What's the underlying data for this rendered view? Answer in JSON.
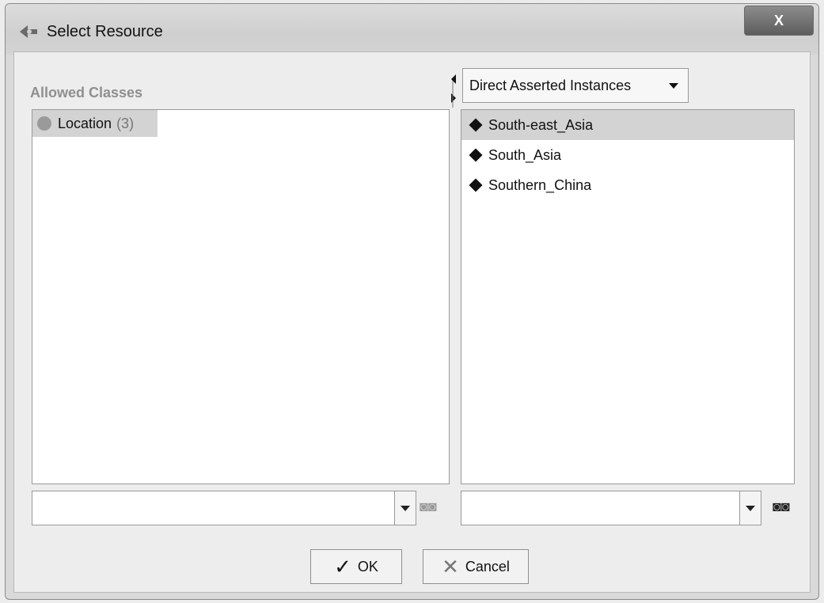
{
  "window": {
    "title": "Select Resource",
    "close_label": "X"
  },
  "left": {
    "heading": "Allowed Classes",
    "items": [
      {
        "label": "Location",
        "count": "(3)"
      }
    ]
  },
  "right": {
    "dropdown": {
      "selected": "Direct Asserted Instances"
    },
    "items": [
      {
        "label": "South-east_Asia",
        "selected": true
      },
      {
        "label": "South_Asia",
        "selected": false
      },
      {
        "label": "Southern_China",
        "selected": false
      }
    ]
  },
  "buttons": {
    "ok_label": "OK",
    "cancel_label": "Cancel"
  },
  "icons": {
    "app": "app-icon",
    "close": "close-icon",
    "class": "class-circle-icon",
    "instance": "diamond-icon",
    "find": "binoculars-icon",
    "ok": "checkmark-icon",
    "cancel": "x-icon"
  }
}
